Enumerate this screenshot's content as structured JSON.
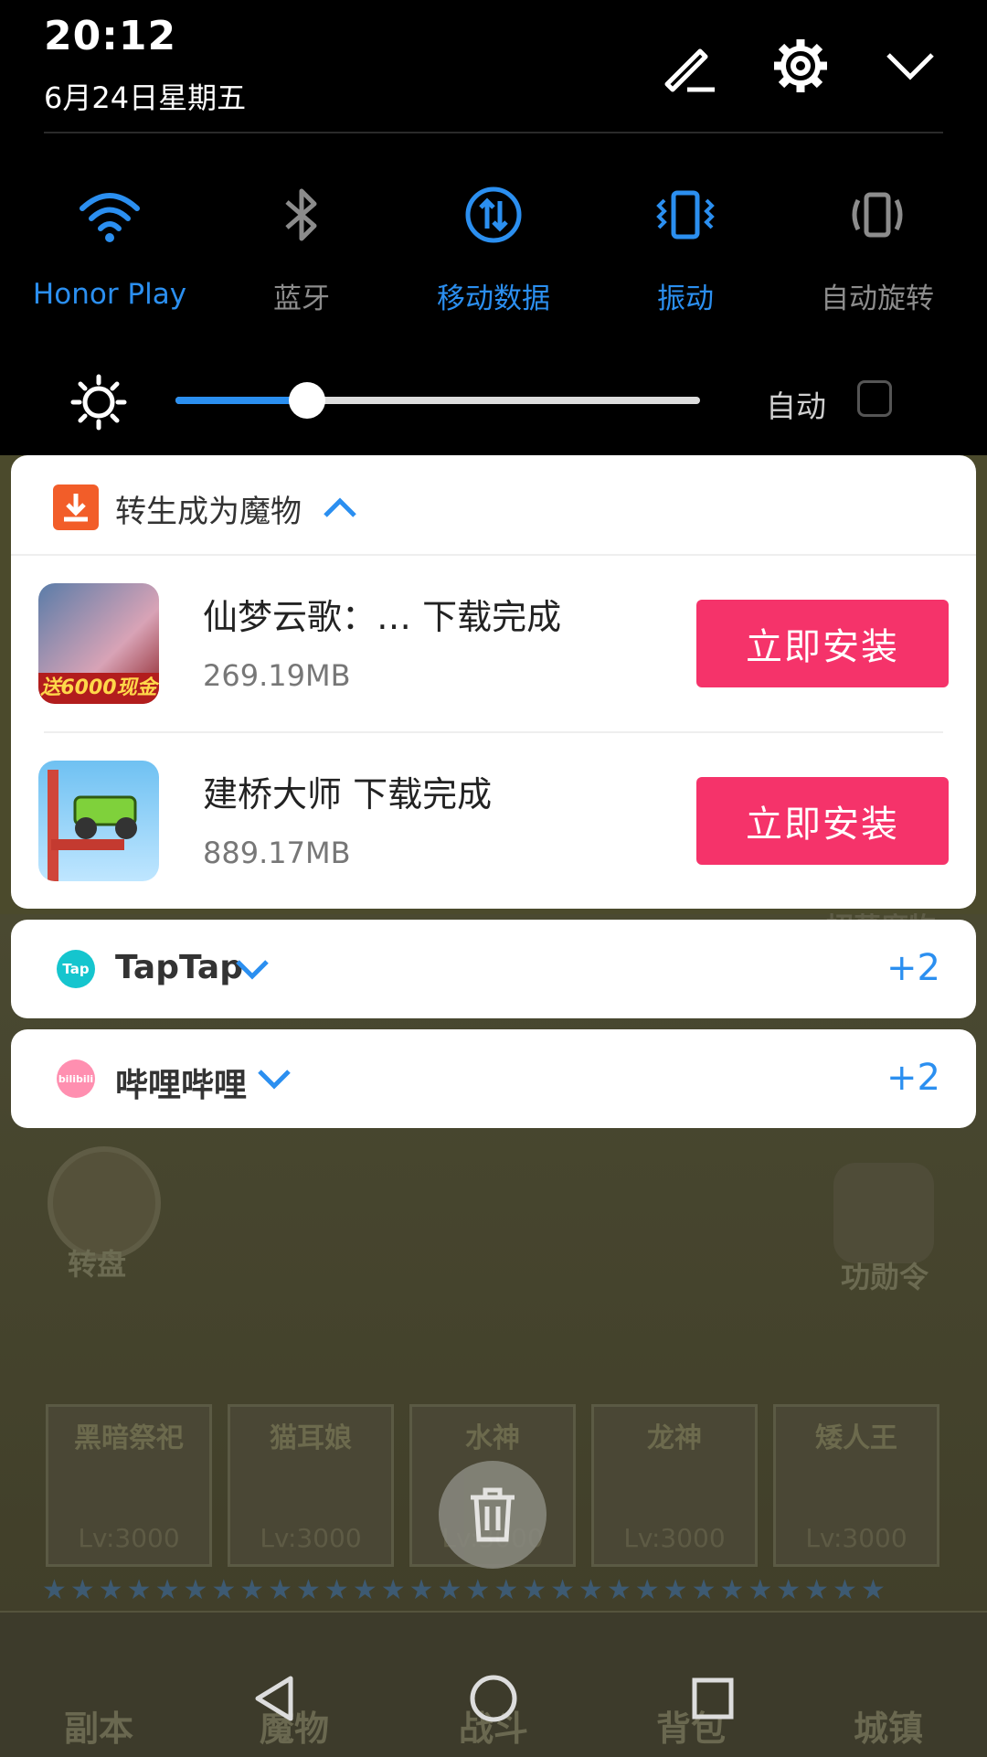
{
  "header": {
    "time": "20:12",
    "date": "6月24日星期五",
    "edit_icon": "pencil-icon",
    "settings_icon": "gear-icon",
    "collapse_icon": "chevron-down-icon"
  },
  "toggles": [
    {
      "label": "Honor Play",
      "icon": "wifi-icon",
      "active": true
    },
    {
      "label": "蓝牙",
      "icon": "bluetooth-icon",
      "active": false
    },
    {
      "label": "移动数据",
      "icon": "mobile-data-icon",
      "active": true
    },
    {
      "label": "振动",
      "icon": "vibrate-icon",
      "active": true
    },
    {
      "label": "自动旋转",
      "icon": "auto-rotate-icon",
      "active": false
    }
  ],
  "brightness": {
    "level": 0.25,
    "auto_label": "自动",
    "auto_checked": false
  },
  "notifications": {
    "download_group": {
      "app": "转生成为魔物",
      "items": [
        {
          "title": "仙梦云歌：…  下载完成",
          "size": "269.19MB",
          "button": "立即安装",
          "thumb_text": "送6000现金"
        },
        {
          "title": "建桥大师  下载完成",
          "size": "889.17MB",
          "button": "立即安装"
        }
      ]
    },
    "taptap": {
      "app": "TapTap",
      "count": "+2",
      "icon_text": "Tap"
    },
    "bilibili": {
      "app": "哔哩哔哩",
      "count": "+2",
      "icon_text": "bilibili"
    }
  },
  "game": {
    "labels": {
      "wheel": "转盘",
      "medal": "功勋令",
      "top_right": "招募魔物"
    },
    "heroes": [
      {
        "name": "黑暗祭祀",
        "level": "Lv:3000"
      },
      {
        "name": "猫耳娘",
        "level": "Lv:3000"
      },
      {
        "name": "水神",
        "level": "Lv:3000"
      },
      {
        "name": "龙神",
        "level": "Lv:3000"
      },
      {
        "name": "矮人王",
        "level": "Lv:3000"
      }
    ],
    "tabs": [
      "副本",
      "魔物",
      "战斗",
      "背包",
      "城镇"
    ],
    "stars": "★★★★★★★★★★★★★★★★★★★★★★★★★★★★★★"
  },
  "colors": {
    "accent": "#2b8ff0",
    "install": "#f5336a",
    "download": "#f25d29"
  }
}
